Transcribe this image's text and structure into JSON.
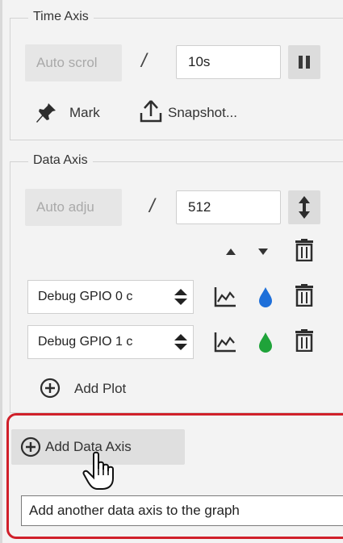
{
  "time_axis": {
    "legend": "Time Axis",
    "scroll_mode": "Auto scrol",
    "separator": "/",
    "window_value": "10s",
    "mark_label": "Mark",
    "snapshot_label": "Snapshot..."
  },
  "data_axis": {
    "legend": "Data Axis",
    "adjust_mode": "Auto adju",
    "separator": "/",
    "range_value": "512",
    "plots": [
      {
        "source": "Debug GPIO 0 c",
        "color": "#1e6fd9"
      },
      {
        "source": "Debug GPIO 1 c",
        "color": "#1fa33a"
      }
    ],
    "add_plot_label": "Add Plot"
  },
  "add_data_axis_label": "Add Data Axis",
  "tooltip_text": "Add another data axis to the graph",
  "colors": {
    "highlight_red": "#d0202a",
    "panel_bg": "#f3f3f3",
    "button_grey": "#dcdcdc"
  }
}
